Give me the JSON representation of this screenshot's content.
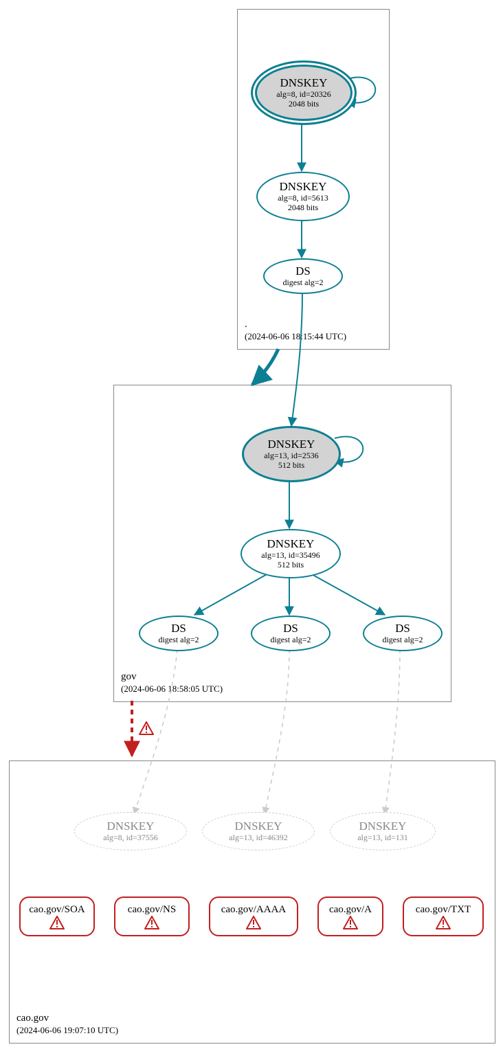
{
  "colors": {
    "teal": "#0d7f93",
    "red": "#c21f1f",
    "gray": "#cccccc",
    "box": "#888888",
    "nodeFill": "#d3d3d3"
  },
  "zones": {
    "root": {
      "label": ".",
      "timestamp": "(2024-06-06 18:15:44 UTC)"
    },
    "gov": {
      "label": "gov",
      "timestamp": "(2024-06-06 18:58:05 UTC)"
    },
    "cao": {
      "label": "cao.gov",
      "timestamp": "(2024-06-06 19:07:10 UTC)"
    }
  },
  "nodes": {
    "rootKsk": {
      "title": "DNSKEY",
      "line1": "alg=8, id=20326",
      "line2": "2048 bits"
    },
    "rootZsk": {
      "title": "DNSKEY",
      "line1": "alg=8, id=5613",
      "line2": "2048 bits"
    },
    "rootDs": {
      "title": "DS",
      "line1": "digest alg=2"
    },
    "govKsk": {
      "title": "DNSKEY",
      "line1": "alg=13, id=2536",
      "line2": "512 bits"
    },
    "govZsk": {
      "title": "DNSKEY",
      "line1": "alg=13, id=35496",
      "line2": "512 bits"
    },
    "govDs1": {
      "title": "DS",
      "line1": "digest alg=2"
    },
    "govDs2": {
      "title": "DS",
      "line1": "digest alg=2"
    },
    "govDs3": {
      "title": "DS",
      "line1": "digest alg=2"
    },
    "caoKey1": {
      "title": "DNSKEY",
      "line1": "alg=8, id=37556"
    },
    "caoKey2": {
      "title": "DNSKEY",
      "line1": "alg=13, id=46392"
    },
    "caoKey3": {
      "title": "DNSKEY",
      "line1": "alg=13, id=131"
    },
    "rrSoa": {
      "title": "cao.gov/SOA"
    },
    "rrNs": {
      "title": "cao.gov/NS"
    },
    "rrAaaa": {
      "title": "cao.gov/AAAA"
    },
    "rrA": {
      "title": "cao.gov/A"
    },
    "rrTxt": {
      "title": "cao.gov/TXT"
    }
  }
}
